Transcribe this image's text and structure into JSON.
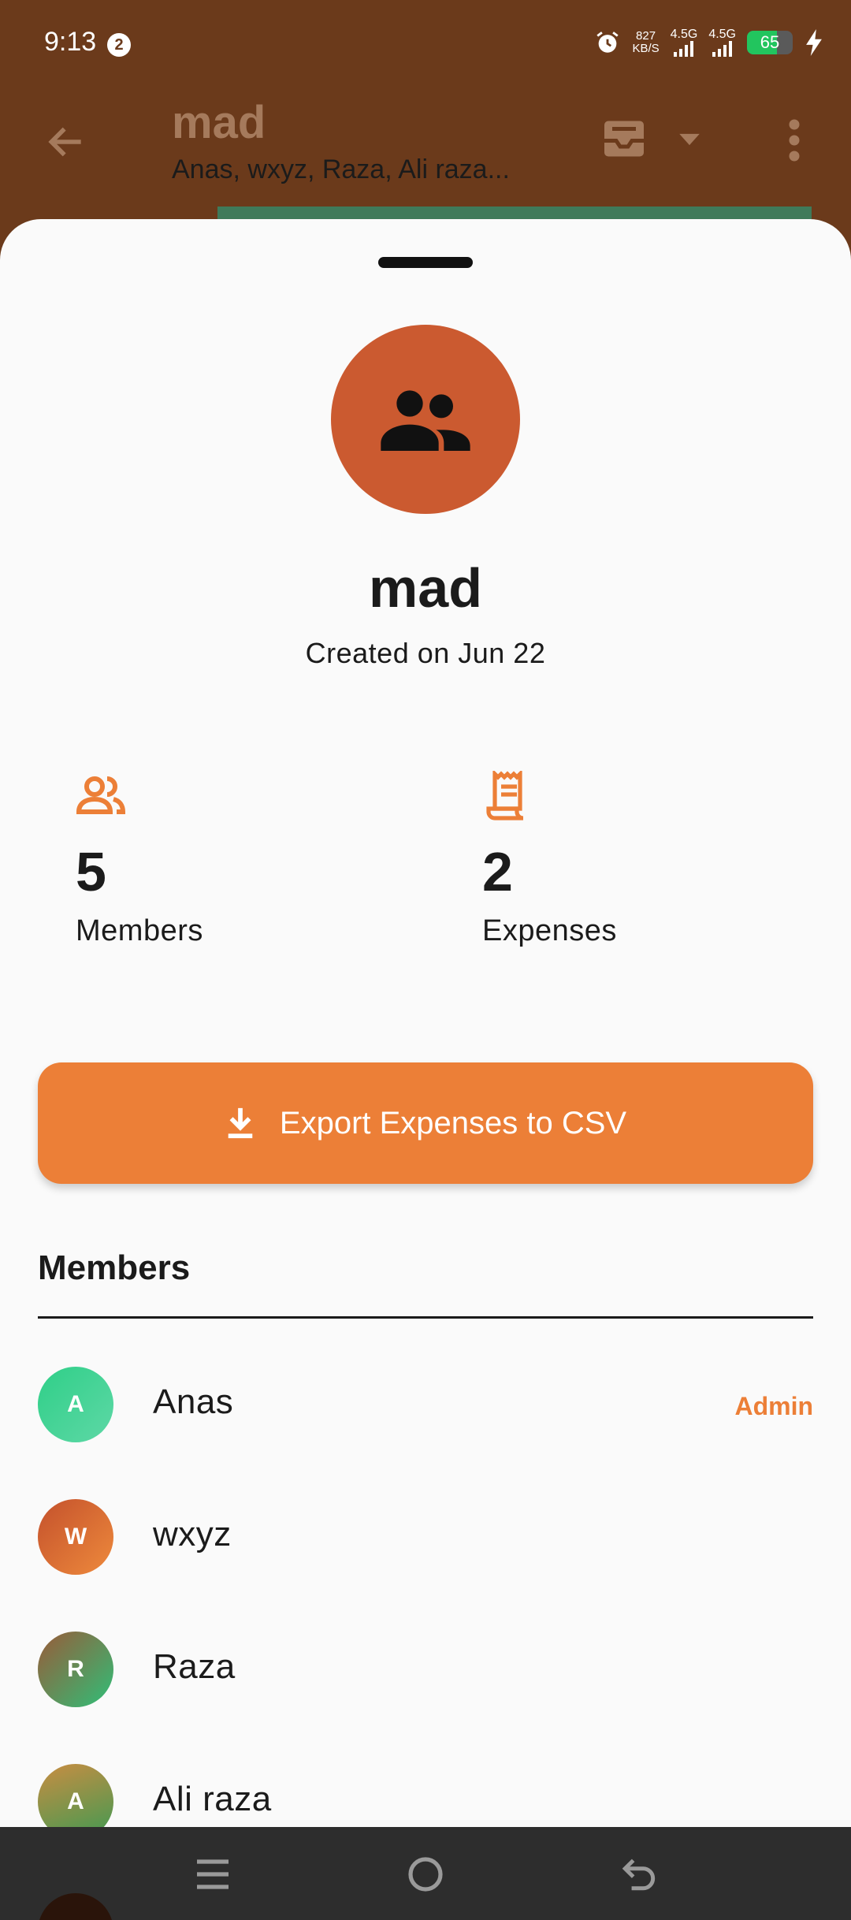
{
  "status_bar": {
    "time": "9:13",
    "notification_count": "2",
    "net_speed_value": "827",
    "net_speed_unit": "KB/S",
    "sim1": "4.5G",
    "sim2": "4.5G",
    "battery_percent": 65
  },
  "app_bar": {
    "title": "mad",
    "subtitle": "Anas, wxyz, Raza, Ali raza..."
  },
  "group": {
    "name": "mad",
    "created_on": "Created on Jun 22"
  },
  "stats": {
    "members_value": "5",
    "members_label": "Members",
    "expenses_value": "2",
    "expenses_label": "Expenses"
  },
  "export_button": {
    "label": "Export Expenses to CSV"
  },
  "members": {
    "title": "Members",
    "list": [
      {
        "initial": "A",
        "name": "Anas",
        "badge": "Admin"
      },
      {
        "initial": "W",
        "name": "wxyz"
      },
      {
        "initial": "R",
        "name": "Raza"
      },
      {
        "initial": "A",
        "name": "Ali raza"
      }
    ]
  },
  "colors": {
    "app_bar": "#6b3a1b",
    "accent": "#ec7f37",
    "group_avatar": "#cb5a30"
  }
}
